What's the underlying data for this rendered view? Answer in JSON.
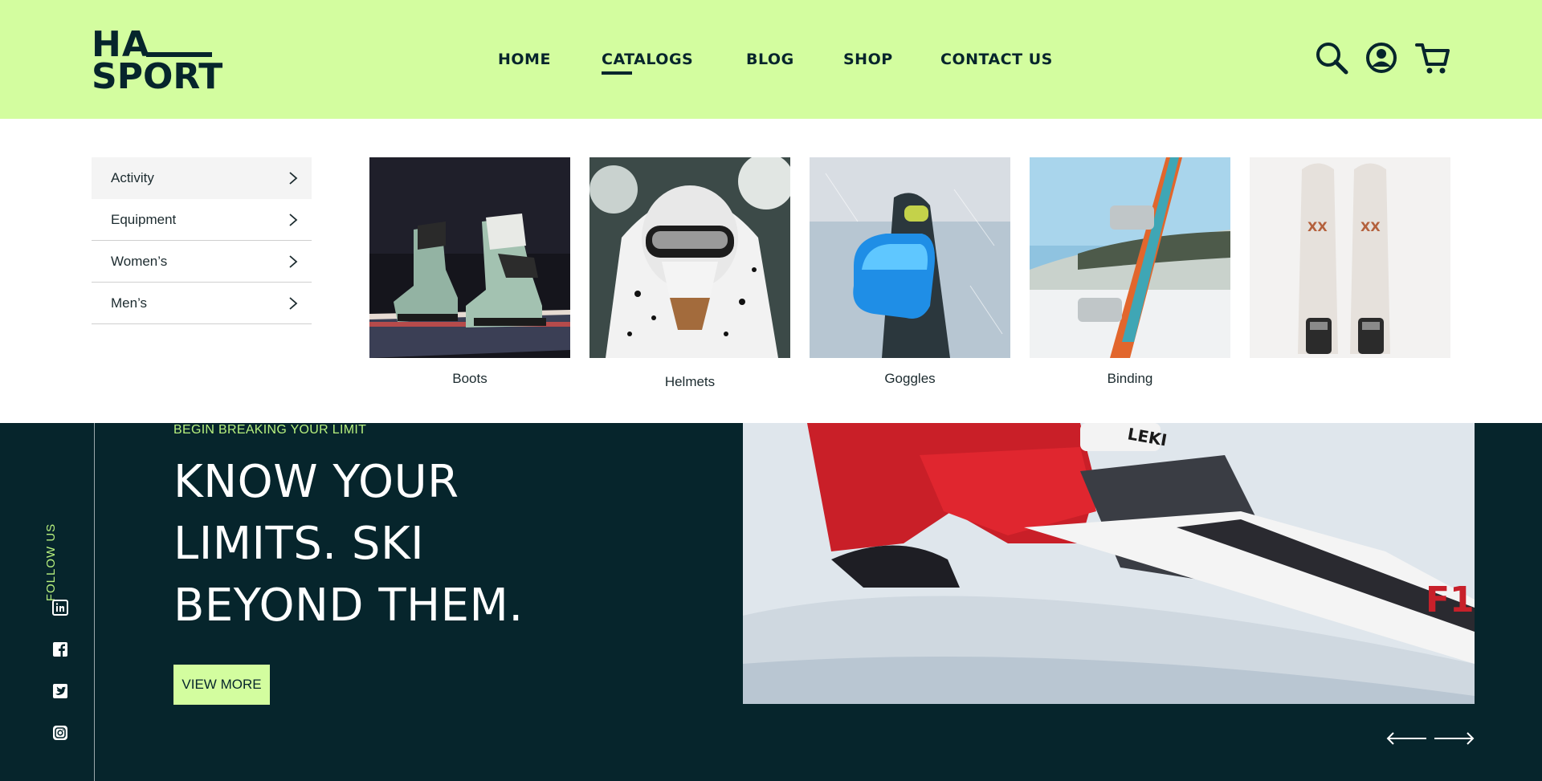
{
  "brand": {
    "line1": "HA",
    "line2": "SPORT"
  },
  "nav": {
    "home": "HOME",
    "catalogs": "CATALOGS",
    "blog": "BLOG",
    "shop": "SHOP",
    "contact": "CONTACT US",
    "active": "CATALOGS"
  },
  "header_icons": [
    "search-icon",
    "account-icon",
    "cart-icon"
  ],
  "mega_menu": {
    "categories": [
      {
        "label": "Activity",
        "active": true
      },
      {
        "label": "Equipment",
        "active": false
      },
      {
        "label": "Women’s",
        "active": false
      },
      {
        "label": "Men’s",
        "active": false
      }
    ],
    "cards": [
      {
        "caption": "Boots"
      },
      {
        "caption": "Helmets"
      },
      {
        "caption": "Goggles"
      },
      {
        "caption": "Binding"
      },
      {
        "caption": ""
      }
    ]
  },
  "hero": {
    "eyebrow": "BEGIN BREAKING YOUR LIMIT",
    "headline_line1": "KNOW YOUR",
    "headline_line2": "LIMITS. SKI",
    "headline_line3": "BEYOND THEM.",
    "cta": "VIEW MORE",
    "follow_label": "FOLLOW US",
    "social_icons": [
      "linkedin-icon",
      "facebook-icon",
      "twitter-icon",
      "instagram-icon"
    ],
    "photo_brand_text": "LEKI"
  },
  "colors": {
    "accent": "#d3fd9f",
    "dark": "#06252c",
    "eyebrow": "#b7f07e",
    "white": "#ffffff"
  }
}
